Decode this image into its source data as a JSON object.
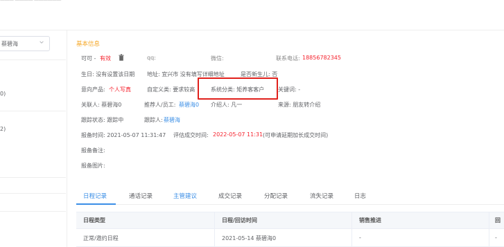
{
  "topbar": {
    "text": "——— ———— ——————"
  },
  "sidebar": {
    "select_value": "蔡碧海",
    "frag1": "0)",
    "frag2": "2)"
  },
  "section_title": "基本信息",
  "info": {
    "name": "可可 -",
    "status": "有效",
    "qq_label": "qq:",
    "wechat_label": "微信:",
    "phone_label": "联系电话:",
    "phone": "18856782345",
    "birthday": "生日: 没有设置该日期",
    "address": "地址: 宜兴市 没有填写详细地址",
    "is_regen": "是否新生儿: 否",
    "intent_label": "意向产品:",
    "intent_value": "个人写真",
    "custom_category": "自定义类: 要求较高",
    "system_category": "系统分类: 矩养客客户",
    "keywords": "关键词: -",
    "contact_person": "关联人: 蔡碧海0",
    "referrer_label": "推荐人/员工:",
    "referrer_value": "蔡碧海0",
    "introducer": "介绍人: 凡一",
    "source": "来源: 朋友转介绍",
    "follow_status": "跟踪状态: 跟踪中",
    "follower_label": "跟踪人:",
    "follower_value": "蔡碧海",
    "report_time": "报备时间: 2021-05-07 11:31:47",
    "eval_time_label": "评估成交时间:",
    "eval_time_value": "2022-05-07 11:31",
    "eval_note": "(可申请延期加长成交时间)",
    "report_note": "报备备注:",
    "report_image": "报备图片:"
  },
  "tabs": [
    "日程记录",
    "通话记录",
    "主管建议",
    "成交记录",
    "分配记录",
    "流失记录",
    "日志"
  ],
  "table": {
    "headers": [
      "日程类型",
      "日程/回访时间",
      "销售推进",
      "回"
    ],
    "rows": [
      [
        "正常/邀约日程",
        "2021-05-14 蔡碧海0",
        "-",
        "-"
      ]
    ]
  },
  "colors": {
    "accent": "#3a8ee6",
    "danger": "#f5222d",
    "section": "#f5a623",
    "highlight": "#e0201b"
  }
}
